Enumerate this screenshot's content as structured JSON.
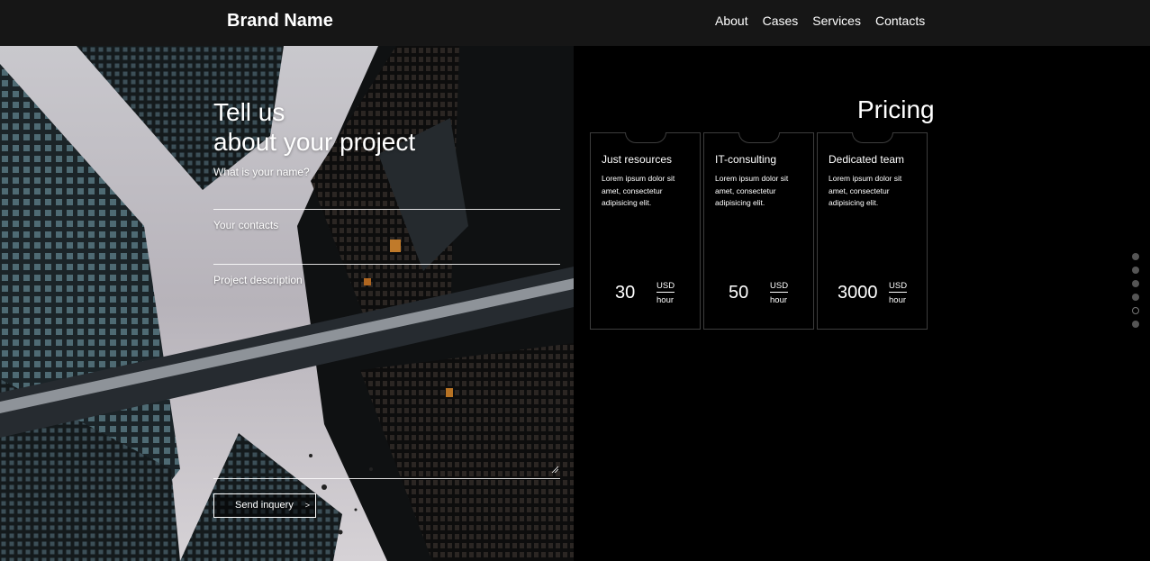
{
  "header": {
    "brand": "Brand Name",
    "nav": [
      {
        "label": "About"
      },
      {
        "label": "Cases"
      },
      {
        "label": "Services"
      },
      {
        "label": "Contacts"
      }
    ]
  },
  "contact_form": {
    "title_line1": "Tell us",
    "title_line2": "about your project",
    "name_label": "What is your name?",
    "contacts_label": "Your contacts",
    "description_label": "Project description",
    "submit_label": "Send inquery",
    "submit_arrow": ">"
  },
  "pricing": {
    "title": "Pricing",
    "cards": [
      {
        "title": "Just resources",
        "description": "Lorem ipsum dolor sit amet, consectetur adipisicing elit.",
        "price": "30",
        "currency": "USD",
        "unit": "hour"
      },
      {
        "title": "IT-consulting",
        "description": "Lorem ipsum dolor sit amet, consectetur adipisicing elit.",
        "price": "50",
        "currency": "USD",
        "unit": "hour"
      },
      {
        "title": "Dedicated team",
        "description": "Lorem ipsum dolor sit amet, consectetur adipisicing elit.",
        "price": "3000",
        "currency": "USD",
        "unit": "hour"
      }
    ]
  },
  "pager": {
    "count": 6,
    "active_index": 4
  },
  "colors": {
    "header_bg": "#161616",
    "page_bg": "#000000",
    "card_border": "#3d3d3d",
    "dot": "#555555"
  }
}
